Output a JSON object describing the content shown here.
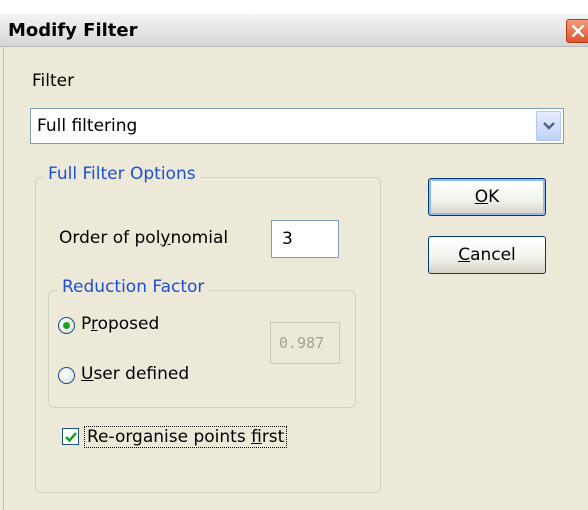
{
  "window": {
    "title": "Modify Filter",
    "close_icon": "close-icon"
  },
  "filter": {
    "label": "Filter",
    "selected": "Full filtering"
  },
  "full_options": {
    "title": "Full Filter Options",
    "order_label": {
      "before": "Order of pol",
      "mnemonic": "y",
      "after": "nomial"
    },
    "order_value": "3",
    "reduction": {
      "title": "Reduction Factor",
      "proposed": {
        "before": "P",
        "mnemonic": "r",
        "after": "oposed",
        "selected": true
      },
      "user_defined": {
        "before": "",
        "mnemonic": "U",
        "after": "ser defined",
        "selected": false
      },
      "factor_value": "0.987"
    },
    "reorganise": {
      "before": "Re-organise points ",
      "mnemonic": "f",
      "after": "irst",
      "checked": true
    }
  },
  "buttons": {
    "ok": {
      "before": "",
      "mnemonic": "O",
      "after": "K"
    },
    "cancel": {
      "before": "",
      "mnemonic": "C",
      "after": "ancel"
    }
  },
  "colors": {
    "group_title": "#1f4ed6",
    "dialog_bg": "#ece9d8",
    "radio_dot": "#21a121",
    "check_mark": "#21a121"
  }
}
